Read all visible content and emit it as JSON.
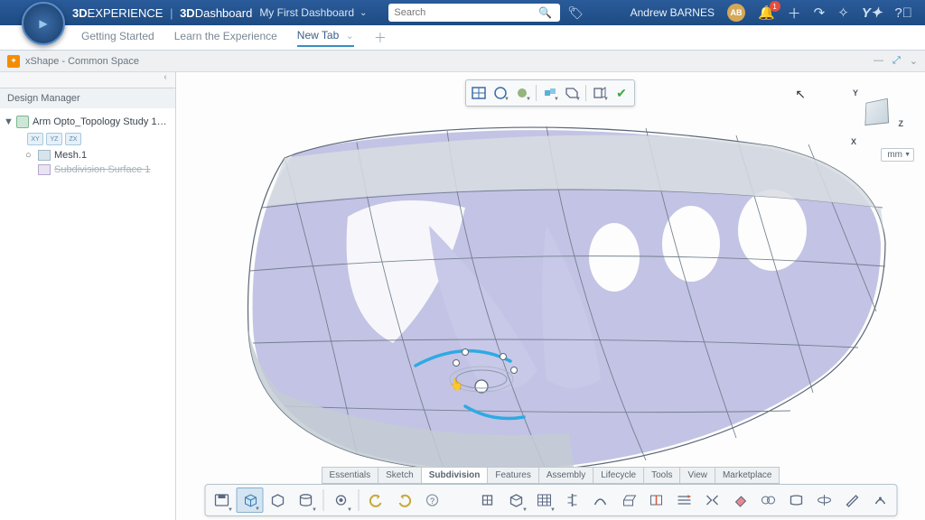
{
  "header": {
    "brand_prefix": "3D",
    "brand_suffix": "EXPERIENCE",
    "app_prefix": "3D",
    "app_suffix": "Dashboard",
    "dashboard_name": "My First Dashboard",
    "search_placeholder": "Search",
    "user": "Andrew BARNES",
    "avatar_initials": "AB",
    "notification_count": "1"
  },
  "tabs": {
    "items": [
      "Getting Started",
      "Learn the Experience",
      "New Tab"
    ],
    "active_index": 2
  },
  "panel": {
    "title": "xShape - Common Space"
  },
  "sidebar": {
    "title": "Design Manager",
    "root": "Arm Opto_Topology Study 1_deform...",
    "planes": [
      "XY",
      "YZ",
      "ZX"
    ],
    "mesh": "Mesh.1",
    "surf": "Subdivision Surface 1"
  },
  "viewport": {
    "axes": {
      "x": "X",
      "y": "Y",
      "z": "Z"
    },
    "units": "mm",
    "bottom_tabs": [
      "Essentials",
      "Sketch",
      "Subdivision",
      "Features",
      "Assembly",
      "Lifecycle",
      "Tools",
      "View",
      "Marketplace"
    ],
    "bottom_active": 2
  }
}
